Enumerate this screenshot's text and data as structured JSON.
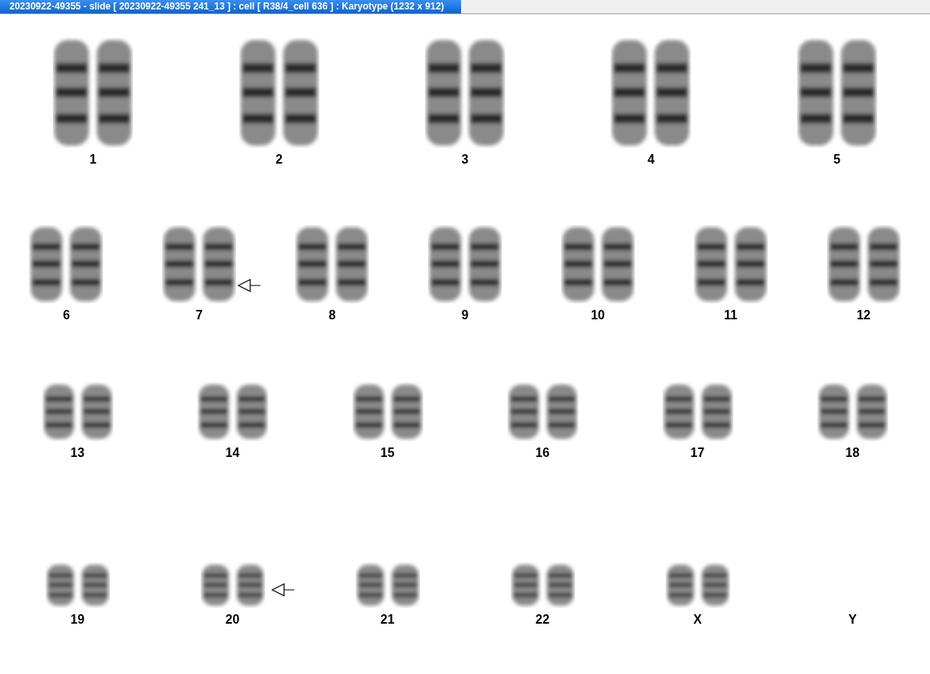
{
  "window": {
    "title": "20230922-49355 - slide [ 20230922-49355 241_13 ] : cell [ R38/4_cell 636 ] : Karyotype  (1232 x 912)"
  },
  "karyotype_rows": [
    {
      "pairs": [
        {
          "label": "1",
          "present": true,
          "arrow": false
        },
        {
          "label": "2",
          "present": true,
          "arrow": false
        },
        {
          "label": "3",
          "present": true,
          "arrow": false
        },
        {
          "label": "4",
          "present": true,
          "arrow": false
        },
        {
          "label": "5",
          "present": true,
          "arrow": false
        }
      ]
    },
    {
      "pairs": [
        {
          "label": "6",
          "present": true,
          "arrow": false
        },
        {
          "label": "7",
          "present": true,
          "arrow": true
        },
        {
          "label": "8",
          "present": true,
          "arrow": false
        },
        {
          "label": "9",
          "present": true,
          "arrow": false
        },
        {
          "label": "10",
          "present": true,
          "arrow": false
        },
        {
          "label": "11",
          "present": true,
          "arrow": false
        },
        {
          "label": "12",
          "present": true,
          "arrow": false
        }
      ]
    },
    {
      "pairs": [
        {
          "label": "13",
          "present": true,
          "arrow": false
        },
        {
          "label": "14",
          "present": true,
          "arrow": false
        },
        {
          "label": "15",
          "present": true,
          "arrow": false
        },
        {
          "label": "16",
          "present": true,
          "arrow": false
        },
        {
          "label": "17",
          "present": true,
          "arrow": false
        },
        {
          "label": "18",
          "present": true,
          "arrow": false
        }
      ]
    },
    {
      "pairs": [
        {
          "label": "19",
          "present": true,
          "arrow": false
        },
        {
          "label": "20",
          "present": true,
          "arrow": true
        },
        {
          "label": "21",
          "present": true,
          "arrow": false
        },
        {
          "label": "22",
          "present": true,
          "arrow": false
        },
        {
          "label": "X",
          "present": true,
          "arrow": false
        },
        {
          "label": "Y",
          "present": false,
          "arrow": false
        }
      ]
    }
  ]
}
